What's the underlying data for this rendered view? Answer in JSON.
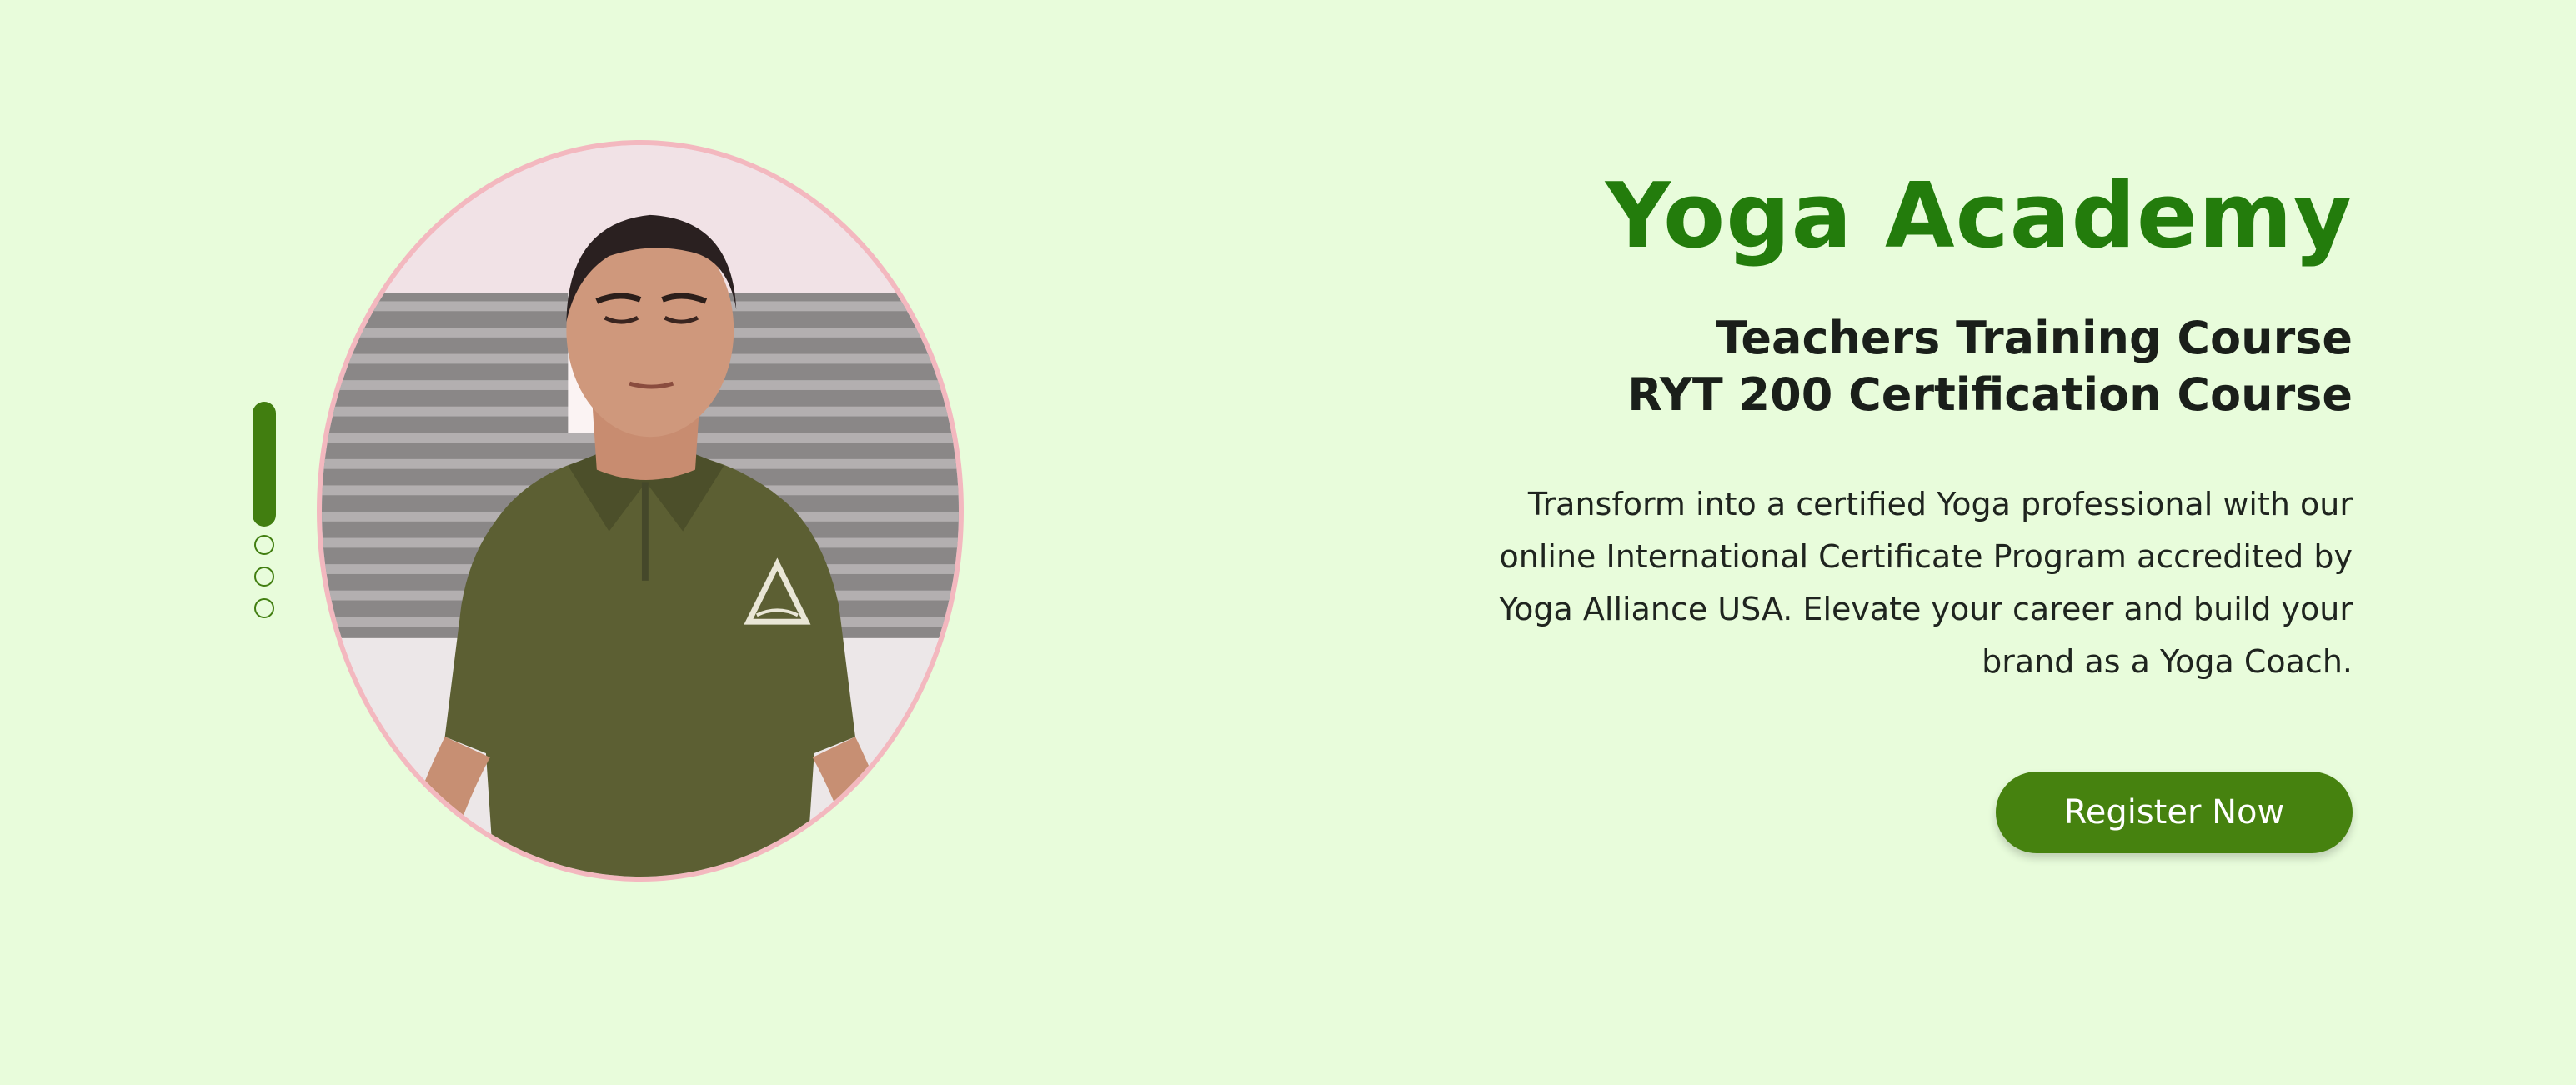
{
  "hero": {
    "brand": "Yoga Academy",
    "subtitle_line1": "Teachers Training Course",
    "subtitle_line2": "RYT 200 Certification Course",
    "description": "Transform into a certified Yoga professional with our online International Certificate Program accredited by Yoga Alliance USA. Elevate your career and build your brand as a Yoga Coach.",
    "cta_label": "Register Now"
  },
  "slider": {
    "slide_count": 4,
    "active_index": 0
  },
  "colors": {
    "background": "#e8fcdb",
    "brand": "#237c0c",
    "accent": "#46820f",
    "portrait_border": "#f3b8bf",
    "heading_text": "#1a1f1a"
  },
  "icons": {
    "portrait_logo": "triangle-logo-icon"
  }
}
